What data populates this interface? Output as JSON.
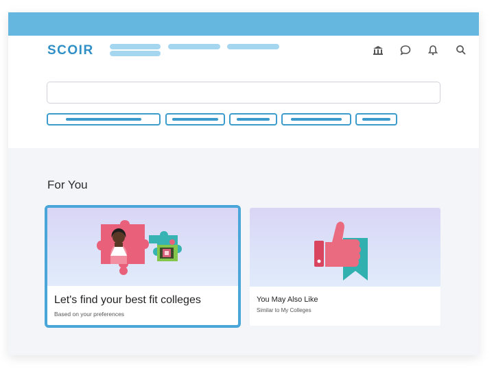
{
  "header": {
    "logo": "SCOIR",
    "icons": [
      "building-icon",
      "chat-icon",
      "bell-icon",
      "search-icon"
    ]
  },
  "section": {
    "title": "For You"
  },
  "cards": [
    {
      "title": "Let's find your best fit colleges",
      "subtitle": "Based on your preferences",
      "image": "puzzle-pieces-illustration"
    },
    {
      "title": "You May Also Like",
      "subtitle": "Similar to My Colleges",
      "image": "thumbs-up-bookmark-illustration"
    }
  ],
  "colors": {
    "topbar": "#66b7df",
    "brand": "#2f8fc6",
    "accent": "#3b9bcd",
    "card_border": "#4aa6d8"
  }
}
